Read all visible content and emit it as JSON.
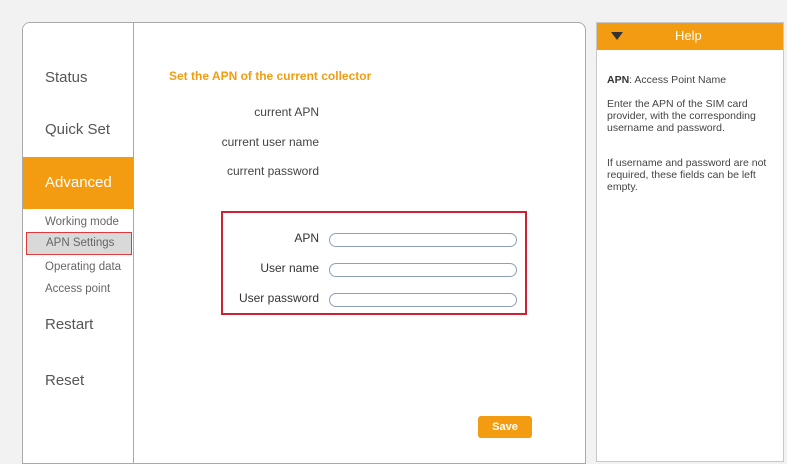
{
  "sidebar": {
    "items": [
      {
        "label": "Status"
      },
      {
        "label": "Quick Set"
      },
      {
        "label": "Advanced"
      },
      {
        "label": "Restart"
      },
      {
        "label": "Reset"
      }
    ],
    "sub_items": [
      {
        "label": "Working mode"
      },
      {
        "label": "APN Settings"
      },
      {
        "label": "Operating data"
      },
      {
        "label": "Access point"
      }
    ],
    "active_item": "Advanced",
    "selected_sub_item": "APN Settings"
  },
  "main": {
    "title": "Set the APN of the current collector",
    "info": {
      "current_apn_label": "current APN",
      "current_user_label": "current user name",
      "current_password_label": "current password"
    },
    "form": {
      "apn_label": "APN",
      "apn_value": "",
      "username_label": "User name",
      "username_value": "",
      "password_label": "User password",
      "password_value": ""
    },
    "save_label": "Save"
  },
  "help": {
    "title": "Help",
    "apn_term": "APN",
    "apn_definition": ": Access Point Name",
    "paragraph1": "Enter the APN of the SIM card provider, with the corresponding username and password.",
    "paragraph2": "If username and password are not required, these fields can be left empty."
  },
  "colors": {
    "accent": "#f39c12",
    "highlight_border": "#cc2233"
  }
}
